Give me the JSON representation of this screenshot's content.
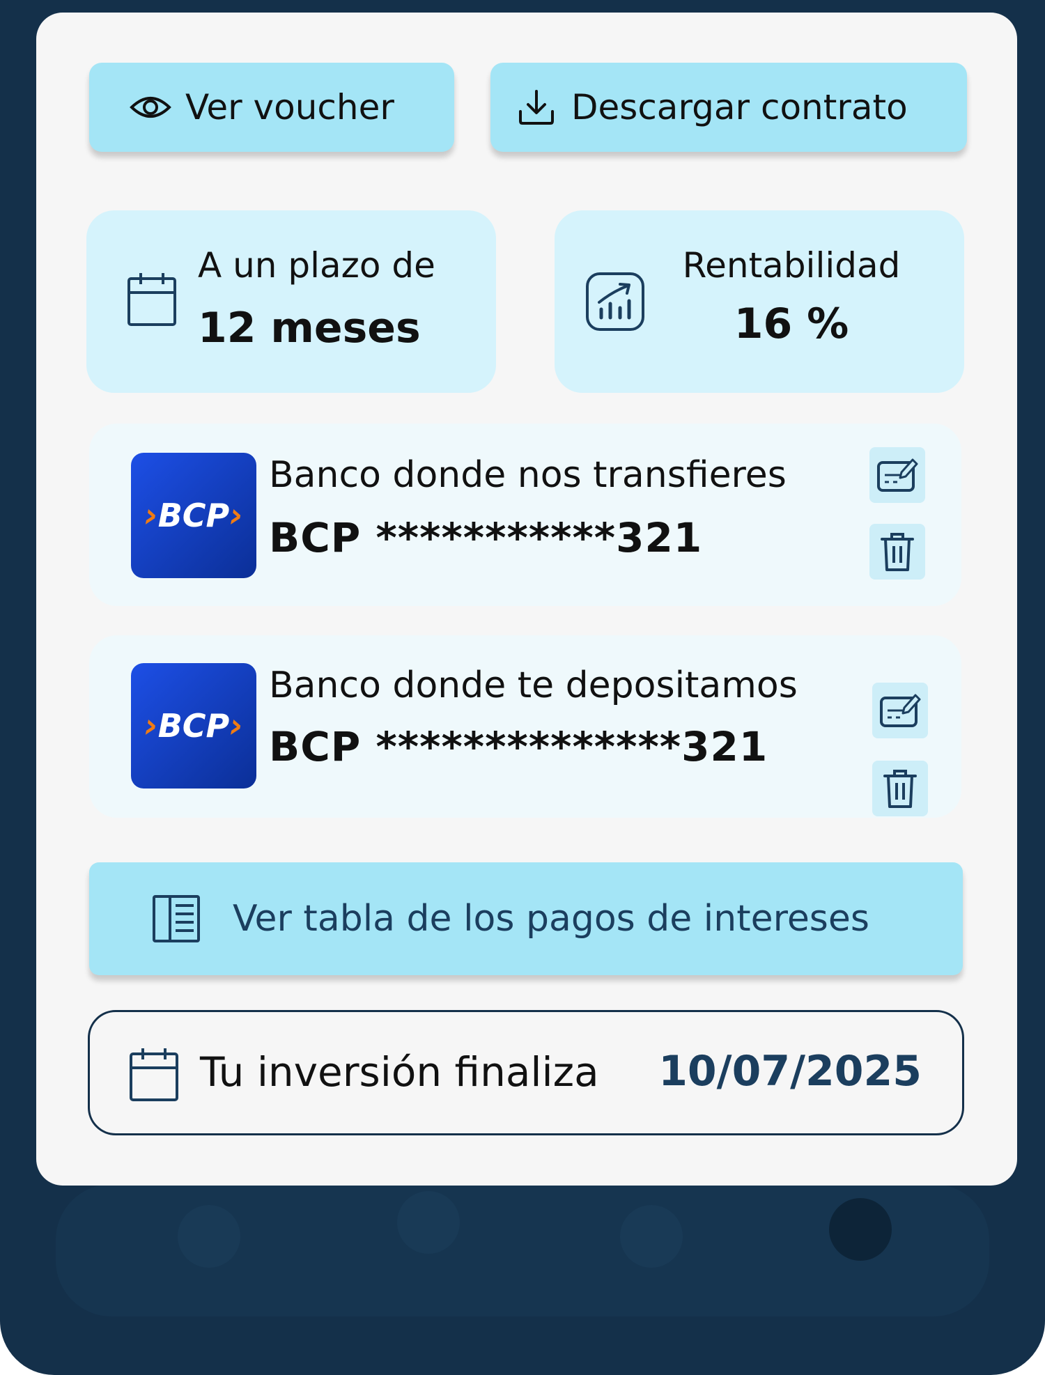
{
  "actions": {
    "view_voucher_label": "Ver voucher",
    "download_contract_label": "Descargar contrato"
  },
  "term": {
    "caption": "A un plazo de",
    "value": "12 meses"
  },
  "profitability": {
    "caption": "Rentabilidad",
    "value": "16 %"
  },
  "banks": [
    {
      "label": "Banco donde nos transfieres",
      "account": "BCP ***********321",
      "logo_text": "BCP"
    },
    {
      "label": "Banco donde te depositamos",
      "account": "BCP **************321",
      "logo_text": "BCP"
    }
  ],
  "interest_table_label": "Ver tabla de los pagos de intereses",
  "maturity": {
    "label": "Tu inversión finaliza",
    "date": "10/07/2025"
  },
  "colors": {
    "background": "#14304a",
    "card": "#f6f6f6",
    "button": "#a4e5f6",
    "stat_card": "#d5f3fc",
    "accent_text": "#1b3e5e",
    "bcp_blue": "#0b2f97",
    "bcp_orange": "#f07c14"
  }
}
